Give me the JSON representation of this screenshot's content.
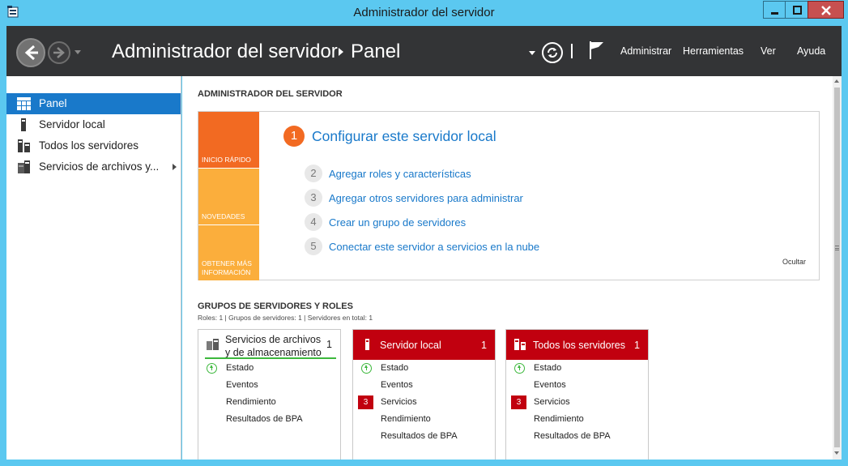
{
  "window": {
    "title": "Administrador del servidor"
  },
  "header": {
    "breadcrumb_root": "Administrador del servidor",
    "breadcrumb_page": "Panel",
    "menu": [
      "Administrar",
      "Herramientas",
      "Ver",
      "Ayuda"
    ]
  },
  "sidebar": {
    "items": [
      {
        "label": "Panel",
        "icon": "dashboard-icon",
        "active": true
      },
      {
        "label": "Servidor local",
        "icon": "server-icon"
      },
      {
        "label": "Todos los servidores",
        "icon": "servers-icon"
      },
      {
        "label": "Servicios de archivos y...",
        "icon": "file-services-icon",
        "expandable": true
      }
    ]
  },
  "welcome": {
    "section_title": "ADMINISTRADOR DEL SERVIDOR",
    "tiles": [
      "INICIO RÁPIDO",
      "NOVEDADES",
      "OBTENER MÁS INFORMACIÓN"
    ],
    "main_step": {
      "num": "1",
      "label": "Configurar este servidor local"
    },
    "steps": [
      {
        "num": "2",
        "label": "Agregar roles y características"
      },
      {
        "num": "3",
        "label": "Agregar otros servidores para administrar"
      },
      {
        "num": "4",
        "label": "Crear un grupo de servidores"
      },
      {
        "num": "5",
        "label": "Conectar este servidor a servicios en la nube"
      }
    ],
    "hide_label": "Ocultar"
  },
  "groups": {
    "section_title": "GRUPOS DE SERVIDORES Y ROLES",
    "subtitle": "Roles: 1   |   Grupos de servidores: 1   |   Servidores en total: 1",
    "cards": [
      {
        "title": "Servicios de archivos y de almacenamiento",
        "count": "1",
        "style": "plain",
        "rows": [
          {
            "label": "Estado",
            "status": "ok"
          },
          {
            "label": "Eventos"
          },
          {
            "label": "Rendimiento"
          },
          {
            "label": "Resultados de BPA"
          }
        ]
      },
      {
        "title": "Servidor local",
        "count": "1",
        "style": "alert",
        "rows": [
          {
            "label": "Estado",
            "status": "ok"
          },
          {
            "label": "Eventos"
          },
          {
            "label": "Servicios",
            "badge": "3"
          },
          {
            "label": "Rendimiento"
          },
          {
            "label": "Resultados de BPA"
          }
        ]
      },
      {
        "title": "Todos los servidores",
        "count": "1",
        "style": "alert",
        "rows": [
          {
            "label": "Estado",
            "status": "ok"
          },
          {
            "label": "Eventos"
          },
          {
            "label": "Servicios",
            "badge": "3"
          },
          {
            "label": "Rendimiento"
          },
          {
            "label": "Resultados de BPA"
          }
        ]
      }
    ]
  },
  "colors": {
    "chrome": "#5bc8f0",
    "header_bg": "#333436",
    "accent_blue": "#1979ca",
    "quick_start_orange": "#f26a22",
    "tile_amber": "#fbae3c",
    "alert_red": "#c1000f",
    "ok_green": "#3db83d"
  }
}
